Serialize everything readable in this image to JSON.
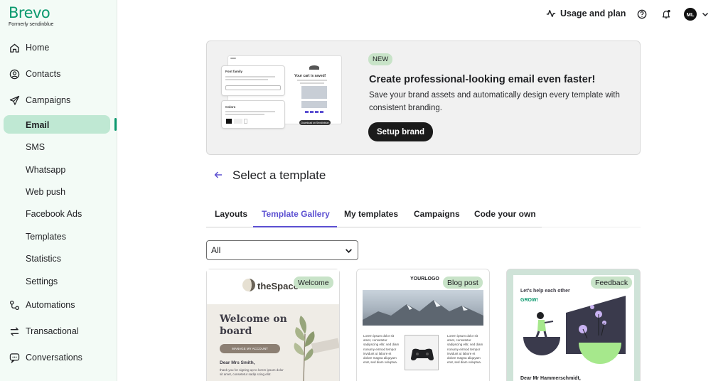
{
  "brand": {
    "name": "Brevo",
    "subtitle": "Formerly sendinblue"
  },
  "sidebar": {
    "items": [
      {
        "label": "Home",
        "icon": "home-icon"
      },
      {
        "label": "Contacts",
        "icon": "contacts-icon"
      },
      {
        "label": "Campaigns",
        "icon": "send-icon"
      },
      {
        "label": "Automations",
        "icon": "automations-icon"
      },
      {
        "label": "Transactional",
        "icon": "transactional-icon"
      },
      {
        "label": "Conversations",
        "icon": "chat-icon"
      }
    ],
    "sub_items": [
      "Email",
      "SMS",
      "Whatsapp",
      "Web push",
      "Facebook Ads",
      "Templates",
      "Statistics",
      "Settings"
    ],
    "active_sub": "Email"
  },
  "topbar": {
    "usage_label": "Usage and plan",
    "avatar_initials": "ML"
  },
  "banner": {
    "badge": "NEW",
    "title": "Create professional-looking email even faster!",
    "description": "Save your brand assets and automatically design every template with consistent branding.",
    "button": "Setup brand",
    "mock": {
      "font_family_label": "Font family",
      "colors_label": "Colors",
      "cart_title": "Your cart is saved!",
      "download_label": "Download on Sendinblue"
    }
  },
  "page": {
    "title": "Select a template"
  },
  "tabs": [
    "Layouts",
    "Template Gallery",
    "My templates",
    "Campaigns",
    "Code your own"
  ],
  "active_tab": "Template Gallery",
  "filter": {
    "selected": "All"
  },
  "cards": [
    {
      "badge": "Welcome",
      "logo": "theSpace",
      "heading": "Welcome on board",
      "button": "MANAGE MY ACCOUNT",
      "greeting": "Dear Mrs Smith,",
      "body": "thank you for signing up to lorem ipsum dolor sit amet, consetetur sadip scing elitr."
    },
    {
      "badge": "Blog post",
      "logo": "YOURLOGO",
      "col_left": "Lorem ipsum dolor sit amet, consetetur sadipscing elitr, sed diam nonumy eirmod tempor invidunt ut labore et dolore magna aliquyam erat, sed diam voluptua.",
      "col_right": "Lorem ipsum dolor sit amet, consetetur sadipscing elitr, sed diam nonumy eirmod tempor invidunt ut labore et dolore magna aliquyam erat, sed diam voluptua."
    },
    {
      "badge": "Feedback",
      "headline": "Let's help each other",
      "headline_accent": "GROW!",
      "greeting": "Dear Mr Hammerschmidt,"
    }
  ],
  "colors": {
    "brand_green": "#0b996e",
    "active_tab": "#5b4fd1",
    "badge_bg": "#c8e3c8",
    "sidebar_bg": "#f3fbf6"
  }
}
